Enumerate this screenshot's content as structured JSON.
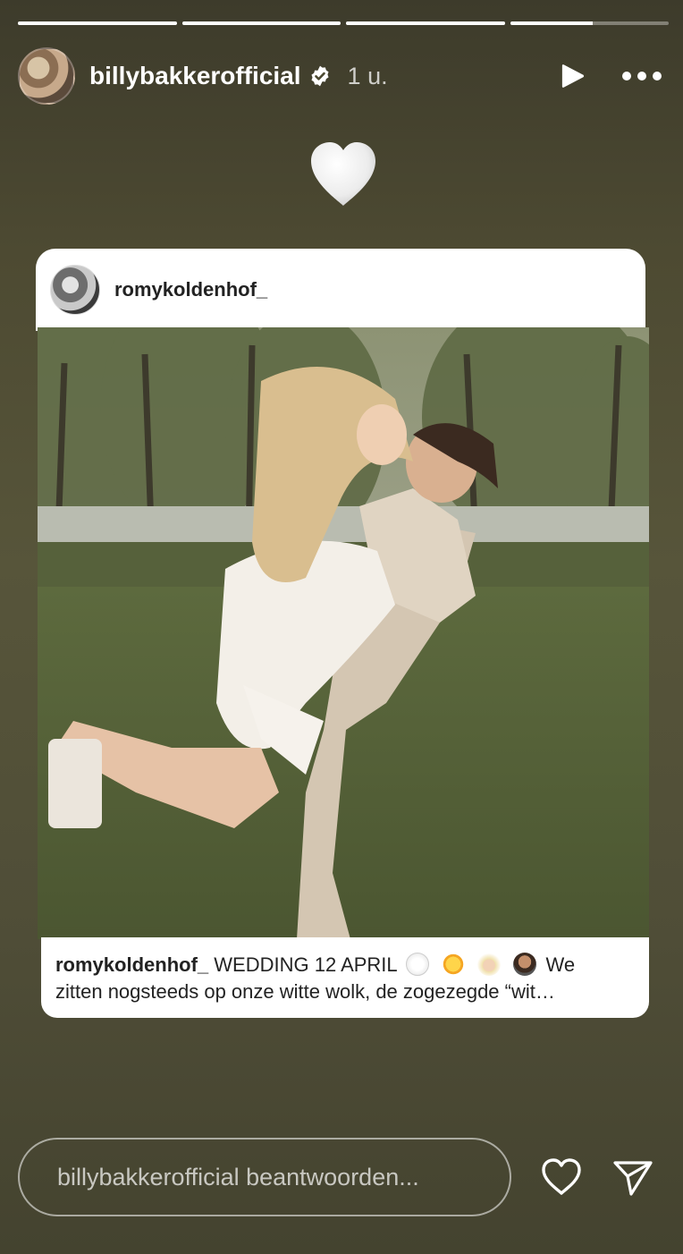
{
  "story": {
    "progress": [
      1,
      1,
      1,
      0.52
    ]
  },
  "header": {
    "username": "billybakkerofficial",
    "time": "1 u.",
    "avatar_icon": "profile-avatar",
    "verified_icon": "verified-badge-icon",
    "play_icon": "play-icon",
    "more_icon": "more-options-icon"
  },
  "sticker": {
    "emoji": "white-heart-emoji"
  },
  "shared_post": {
    "username": "romykoldenhof_",
    "multi_image": true,
    "caption": {
      "user": "romykoldenhof_",
      "line1_text": "WEDDING 12 APRIL",
      "line1_emojis": [
        "white-heart",
        "sun",
        "bride",
        "groom"
      ],
      "line1_tail": "We",
      "line2": "zitten nogsteeds op onze witte wolk, de zogezegde “wit…"
    }
  },
  "reply": {
    "placeholder": "billybakkerofficial beantwoorden..."
  },
  "colors": {
    "background": "#4d4a32",
    "card": "#ffffff"
  }
}
